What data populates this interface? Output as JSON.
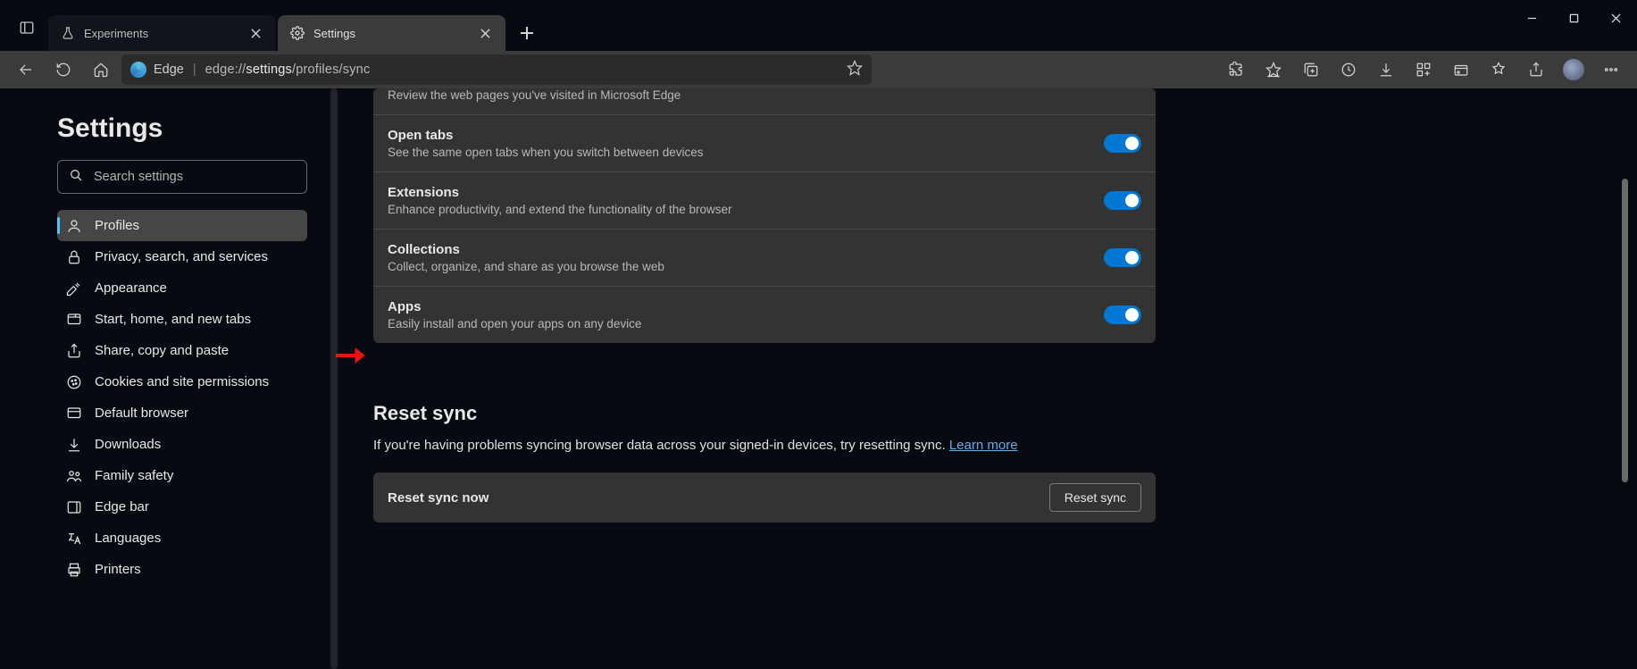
{
  "tabs": [
    {
      "title": "Experiments"
    },
    {
      "title": "Settings"
    }
  ],
  "omnibox": {
    "product": "Edge",
    "url_prefix": "edge://",
    "url_bold": "settings",
    "url_suffix": "/profiles/sync"
  },
  "page": {
    "title": "Settings"
  },
  "search": {
    "placeholder": "Search settings"
  },
  "nav": {
    "profiles": "Profiles",
    "privacy": "Privacy, search, and services",
    "appearance": "Appearance",
    "start": "Start, home, and new tabs",
    "share": "Share, copy and paste",
    "cookies": "Cookies and site permissions",
    "default_browser": "Default browser",
    "downloads": "Downloads",
    "family": "Family safety",
    "edgebar": "Edge bar",
    "languages": "Languages",
    "printers": "Printers"
  },
  "sync": {
    "history_desc": "Review the web pages you've visited in Microsoft Edge",
    "open_tabs": {
      "title": "Open tabs",
      "desc": "See the same open tabs when you switch between devices"
    },
    "extensions": {
      "title": "Extensions",
      "desc": "Enhance productivity, and extend the functionality of the browser"
    },
    "collections": {
      "title": "Collections",
      "desc": "Collect, organize, and share as you browse the web"
    },
    "apps": {
      "title": "Apps",
      "desc": "Easily install and open your apps on any device"
    }
  },
  "reset": {
    "heading": "Reset sync",
    "body": "If you're having problems syncing browser data across your signed-in devices, try resetting sync. ",
    "learn_more": "Learn more",
    "row_label": "Reset sync now",
    "button": "Reset sync"
  }
}
